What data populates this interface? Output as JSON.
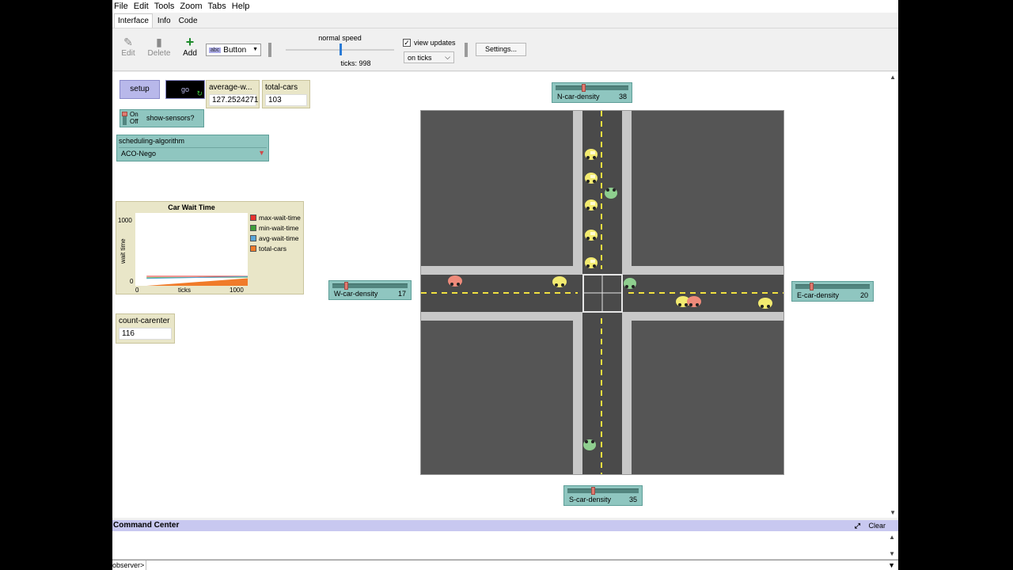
{
  "menu": [
    "File",
    "Edit",
    "Tools",
    "Zoom",
    "Tabs",
    "Help"
  ],
  "tabs": [
    "Interface",
    "Info",
    "Code"
  ],
  "toolbar": {
    "edit_label": "Edit",
    "delete_label": "Delete",
    "add_label": "Add",
    "widget_type": "Button",
    "speed_label": "normal speed",
    "ticks_label": "ticks: 998",
    "speed_level_fraction": 0.5,
    "view_updates_label": "view updates",
    "view_updates_checked": true,
    "update_mode": "on ticks",
    "settings_label": "Settings..."
  },
  "widgets": {
    "setup_label": "setup",
    "go_label": "go",
    "average_wait_label": "average-w...",
    "average_wait_value": "127.2524271",
    "total_cars_label": "total-cars",
    "total_cars_value": "103",
    "show_sensors_on": "On",
    "show_sensors_off": "Off",
    "show_sensors_label": "show-sensors?",
    "scheduling_label": "scheduling-algorithm",
    "scheduling_value": "ACO-Nego",
    "count_carenter_label": "count-carenter",
    "count_carenter_value": "116"
  },
  "sliders": {
    "north": {
      "label": "N-car-density",
      "value": "38",
      "fraction": 0.38
    },
    "west": {
      "label": "W-car-density",
      "value": "17",
      "fraction": 0.17
    },
    "east": {
      "label": "E-car-density",
      "value": "20",
      "fraction": 0.2
    },
    "south": {
      "label": "S-car-density",
      "value": "35",
      "fraction": 0.35
    }
  },
  "plot": {
    "title": "Car Wait Time",
    "ylabel": "wait time",
    "xlabel": "ticks",
    "y_min": "0",
    "y_max": "1000",
    "x_min": "0",
    "x_max": "1000",
    "legend": [
      {
        "name": "max-wait-time",
        "color": "#e8322e"
      },
      {
        "name": "min-wait-time",
        "color": "#3e9e3a"
      },
      {
        "name": "avg-wait-time",
        "color": "#5aa6d8"
      },
      {
        "name": "total-cars",
        "color": "#f07b2a"
      }
    ]
  },
  "chart_data": {
    "type": "area",
    "title": "Car Wait Time",
    "xlabel": "ticks",
    "ylabel": "wait time",
    "xlim": [
      0,
      1000
    ],
    "ylim": [
      0,
      1000
    ],
    "legend_position": "right",
    "series": [
      {
        "name": "max-wait-time",
        "x": [
          100,
          1000
        ],
        "y": [
          130,
          130
        ]
      },
      {
        "name": "min-wait-time",
        "x": [
          100,
          1000
        ],
        "y": [
          110,
          120
        ]
      },
      {
        "name": "avg-wait-time",
        "x": [
          100,
          1000
        ],
        "y": [
          100,
          127
        ]
      },
      {
        "name": "total-cars",
        "x": [
          100,
          1000
        ],
        "y": [
          0,
          103
        ]
      }
    ]
  },
  "command_center": {
    "title": "Command Center",
    "clear_label": "Clear",
    "prompt": "observer>"
  }
}
